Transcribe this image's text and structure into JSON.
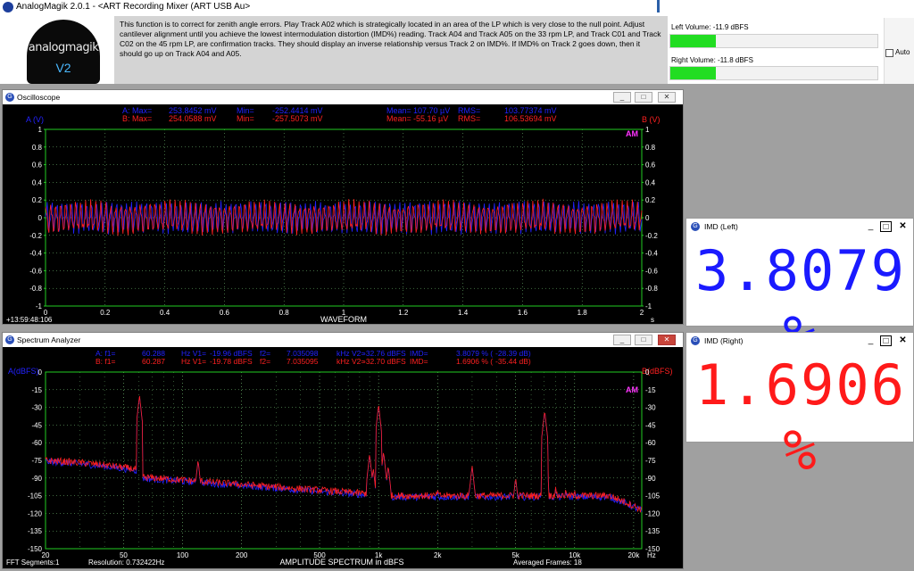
{
  "app": {
    "title": "AnalogMagik 2.0.1  -   <ART Recording Mixer (ART USB Au>"
  },
  "logo": {
    "text": "analogmagik",
    "version": "V2"
  },
  "info": {
    "text": "This function is to correct for zenith angle errors.  Play Track A02 which is strategically located in an area of the LP which is very close to the null point.   Adjust cantilever alignment until you achieve the lowest intermodulation distortion (IMD%) reading.  Track A04 and Track A05 on the 33 rpm LP, and Track C01 and Track C02 on the 45 rpm LP, are confirmation tracks.  They should display an inverse relationship versus Track 2 on IMD%.  If IMD% on Track 2 goes down, then it should go up on Track A04 and A05."
  },
  "volume": {
    "left_label": "Left Volume:   -11.9 dBFS",
    "right_label": "Right Volume:  -11.8 dBFS",
    "left_level": 0.22,
    "right_level": 0.22,
    "auto_label": "Auto",
    "bar_color": "#22dd22"
  },
  "oscilloscope": {
    "title": "Oscilloscope",
    "stats_a": [
      "A: Max=",
      "253.8452 mV",
      "Min=",
      "-252.4414 mV",
      "Mean=",
      "107.70 µV",
      "RMS=",
      "103.77374 mV"
    ],
    "stats_b": [
      "B: Max=",
      "254.0588 mV",
      "Min=",
      "-257.5073 mV",
      "Mean=",
      "-55.16 µV",
      "RMS=",
      "106.53694 mV"
    ],
    "left_axis_label": "A (V)",
    "right_axis_label": "B (V)",
    "am": "AM",
    "xlabel": "WAVEFORM",
    "xunit": "s",
    "timestamp": "+13:59:48:106",
    "y_ticks": [
      "1",
      "0.8",
      "0.6",
      "0.4",
      "0.2",
      "0",
      "-0.2",
      "-0.4",
      "-0.6",
      "-0.8",
      "-1"
    ],
    "x_ticks": [
      "0",
      "0.2",
      "0.4",
      "0.6",
      "0.8",
      "1",
      "1.2",
      "1.4",
      "1.6",
      "1.8",
      "2"
    ]
  },
  "spectrum": {
    "title": "Spectrum Analyzer",
    "stats_a": [
      "A: f1=",
      "60.288",
      "Hz V1=",
      "-19.96 dBFS",
      "f2=",
      "7.035098",
      "kHz V2=",
      "-32.76 dBFS",
      "IMD=",
      "3.8079 % (",
      "-28.39 dB)"
    ],
    "stats_b": [
      "B: f1=",
      "60.287",
      "Hz V1=",
      "-19.78 dBFS",
      "f2=",
      "7.035095",
      "kHz V2=",
      "-32.70 dBFS",
      "IMD=",
      "1.6906 % (",
      "-35.44 dB)"
    ],
    "left_axis_label": "A(dBFS)",
    "right_axis_label": "B(dBFS)",
    "am": "AM",
    "y_ticks": [
      "0",
      "-15",
      "-30",
      "-45",
      "-60",
      "-75",
      "-90",
      "-105",
      "-120",
      "-135",
      "-150"
    ],
    "x_ticks": [
      "20",
      "50",
      "100",
      "200",
      "500",
      "1k",
      "2k",
      "5k",
      "10k",
      "20k"
    ],
    "xunit": "Hz",
    "xlabel": "AMPLITUDE SPECTRUM in dBFS",
    "fft_segments": "FFT Segments:1",
    "resolution": "Resolution: 0.732422Hz",
    "averaged": "Averaged Frames: 18"
  },
  "imd_left": {
    "title": "IMD (Left)",
    "value": "3.8079 %",
    "color": "#1a1aff"
  },
  "imd_right": {
    "title": "IMD (Right)",
    "value": "1.6906 %",
    "color": "#ff1a1a"
  },
  "colors": {
    "series_a": "#2222ff",
    "series_b": "#ff2020",
    "grid": "#7fd37f",
    "axis_text": "#ffffff",
    "accent_text": "#22cc22",
    "am": "#ff33ff"
  }
}
